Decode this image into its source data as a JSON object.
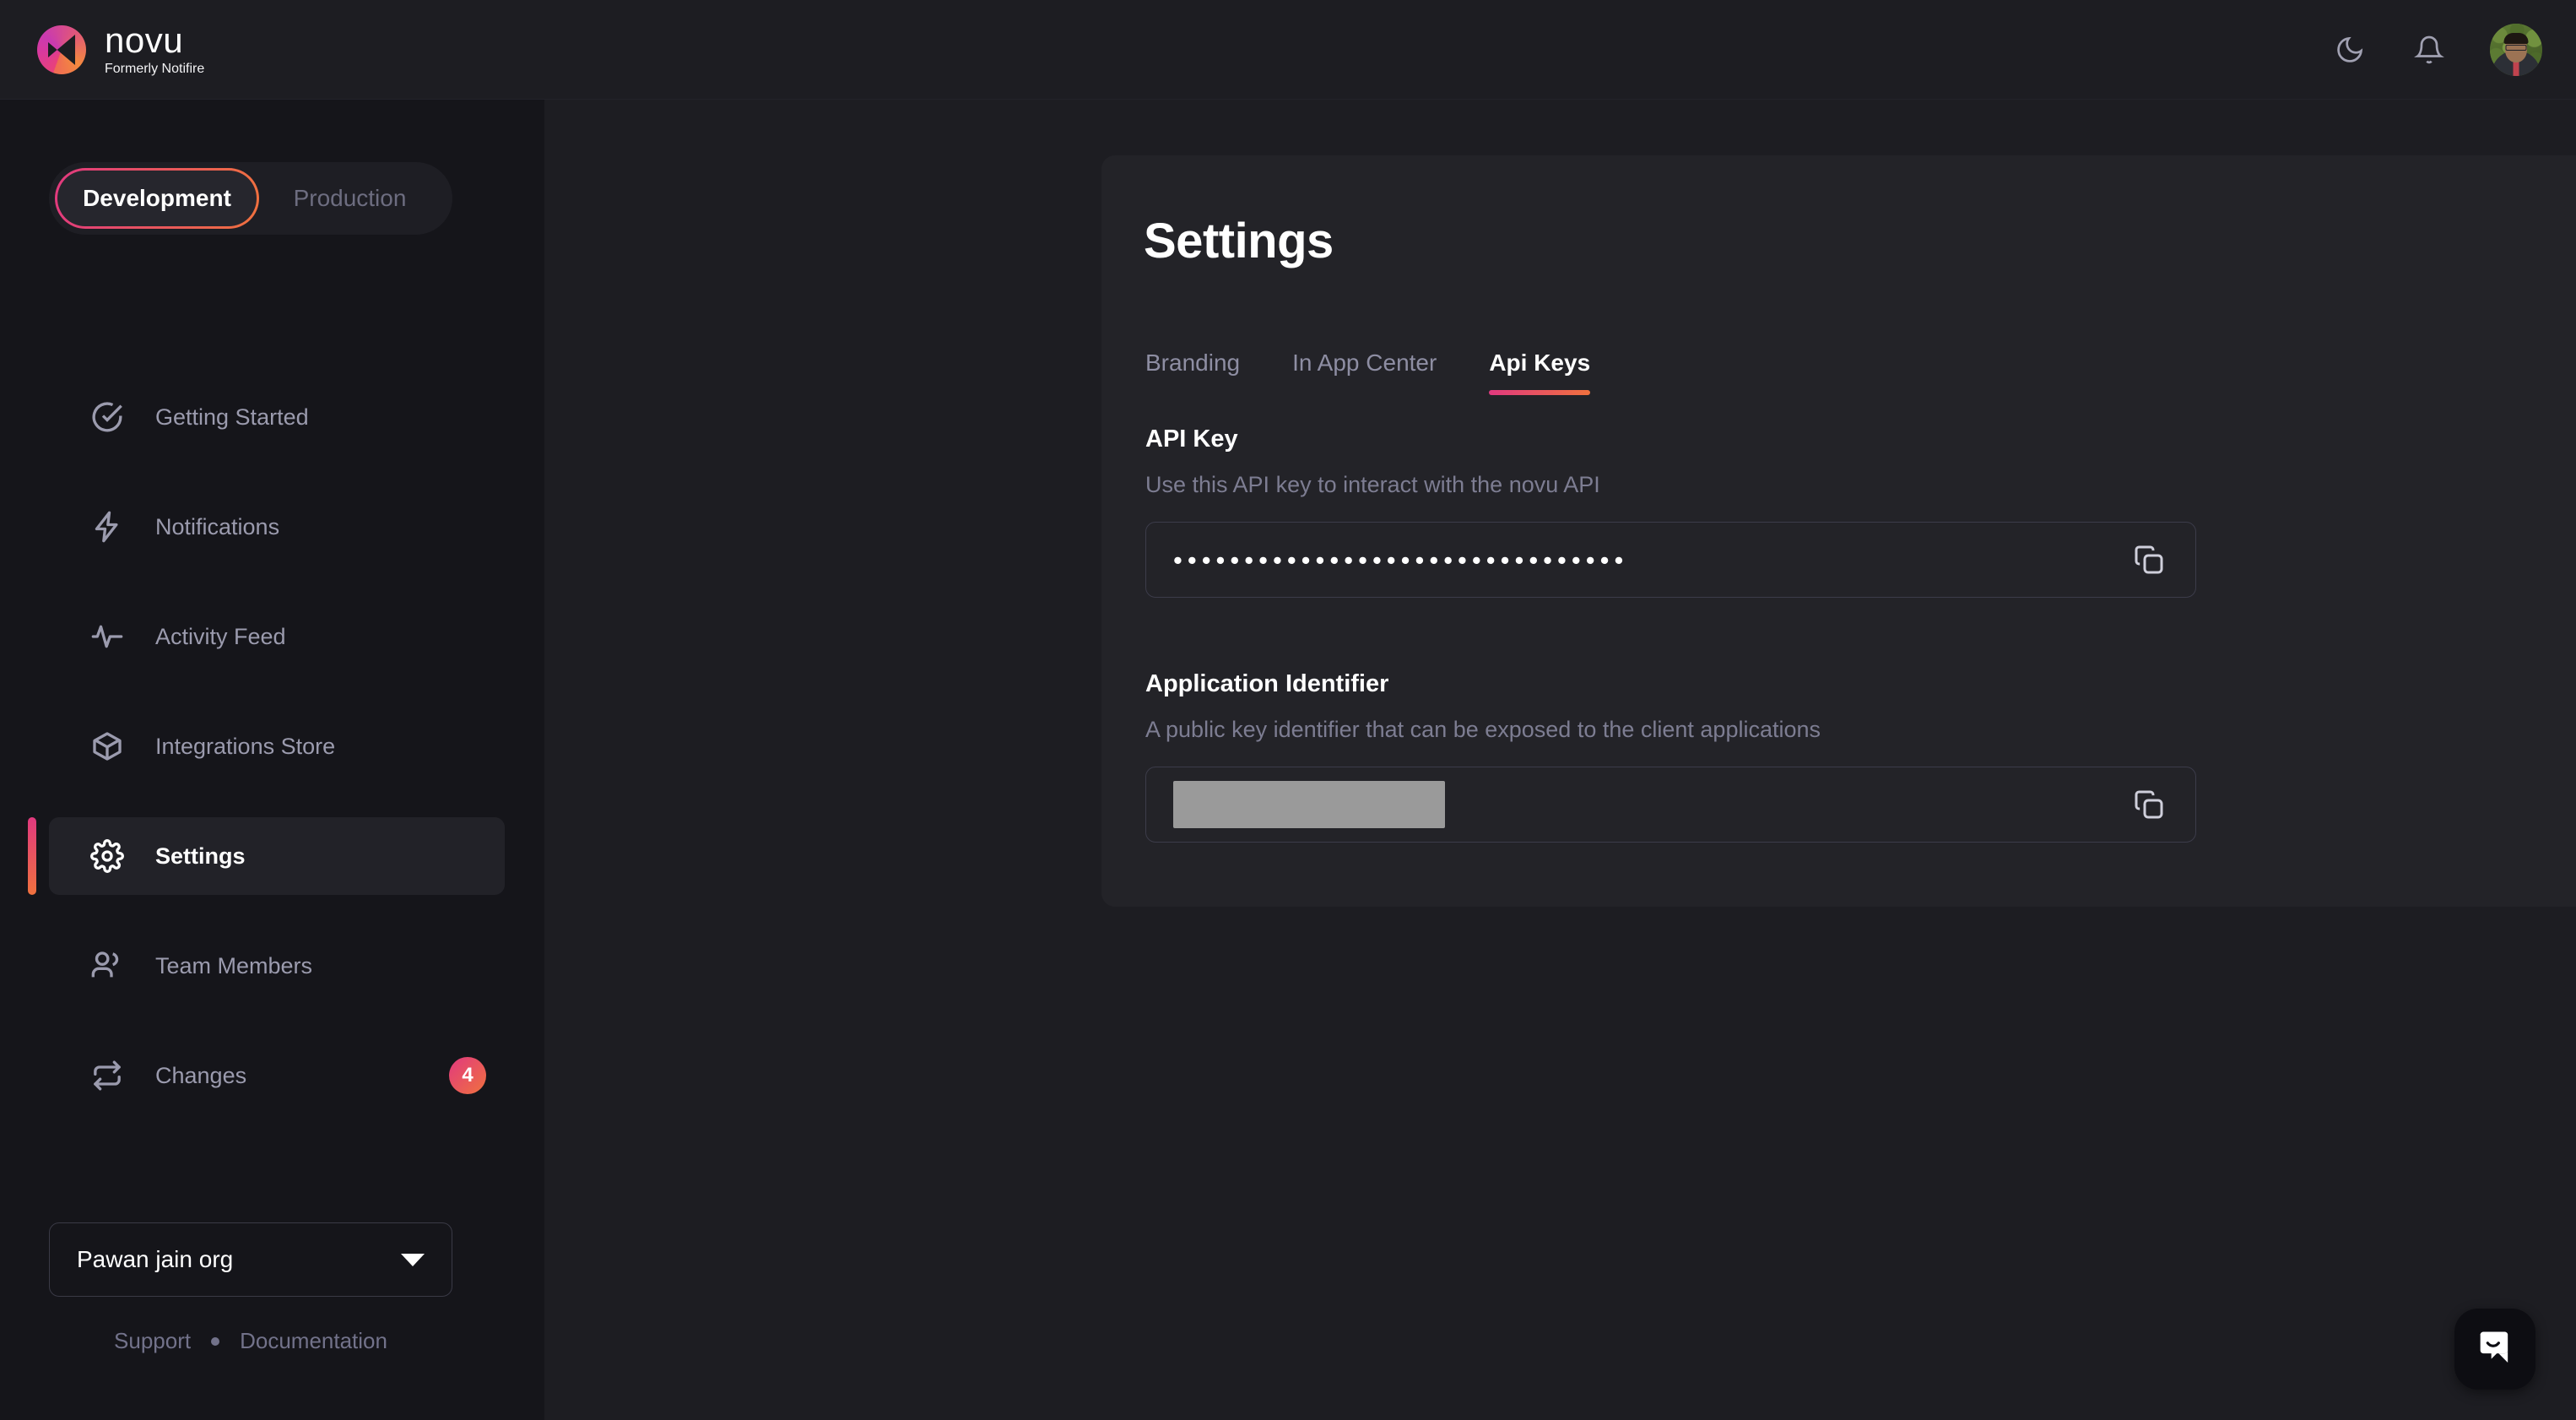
{
  "header": {
    "logo_word": "novu",
    "logo_sub": "Formerly Notifire",
    "theme_toggle_icon": "moon-icon",
    "notifications_icon": "bell-icon",
    "avatar_icon": "user-avatar"
  },
  "sidebar": {
    "env_switch": {
      "active": "Development",
      "inactive": "Production"
    },
    "items": [
      {
        "label": "Getting Started",
        "icon": "check-circle-icon",
        "active": false,
        "badge": null
      },
      {
        "label": "Notifications",
        "icon": "bolt-icon",
        "active": false,
        "badge": null
      },
      {
        "label": "Activity Feed",
        "icon": "activity-pulse-icon",
        "active": false,
        "badge": null
      },
      {
        "label": "Integrations Store",
        "icon": "cube-box-icon",
        "active": false,
        "badge": null
      },
      {
        "label": "Settings",
        "icon": "gear-icon",
        "active": true,
        "badge": null
      },
      {
        "label": "Team Members",
        "icon": "users-icon",
        "active": false,
        "badge": null
      },
      {
        "label": "Changes",
        "icon": "repeat-arrows-icon",
        "active": false,
        "badge": "4"
      }
    ],
    "org": {
      "name": "Pawan jain org",
      "caret_icon": "chevron-down-icon"
    },
    "footer": {
      "support": "Support",
      "documentation": "Documentation"
    }
  },
  "main": {
    "title": "Settings",
    "tabs": [
      {
        "label": "Branding",
        "active": false
      },
      {
        "label": "In App Center",
        "active": false
      },
      {
        "label": "Api Keys",
        "active": true
      }
    ],
    "api_key": {
      "label": "API Key",
      "description": "Use this API key to interact with the novu API",
      "value": "••••••••••••••••••••••••••••••••",
      "copy_icon": "copy-icon"
    },
    "app_identifier": {
      "label": "Application Identifier",
      "description": "A public key identifier that can be exposed to the client applications",
      "value": "",
      "copy_icon": "copy-icon"
    }
  },
  "chat_widget": {
    "icon": "chat-bubble-smile-icon"
  },
  "colors": {
    "page_bg": "#17171b",
    "sidebar_bg": "#15151a",
    "main_bg": "#1d1d22",
    "card_bg": "#232328",
    "accent_start": "#e1397f",
    "accent_end": "#f0713e",
    "text_primary": "#ffffff",
    "text_muted": "#8e8ea3"
  }
}
